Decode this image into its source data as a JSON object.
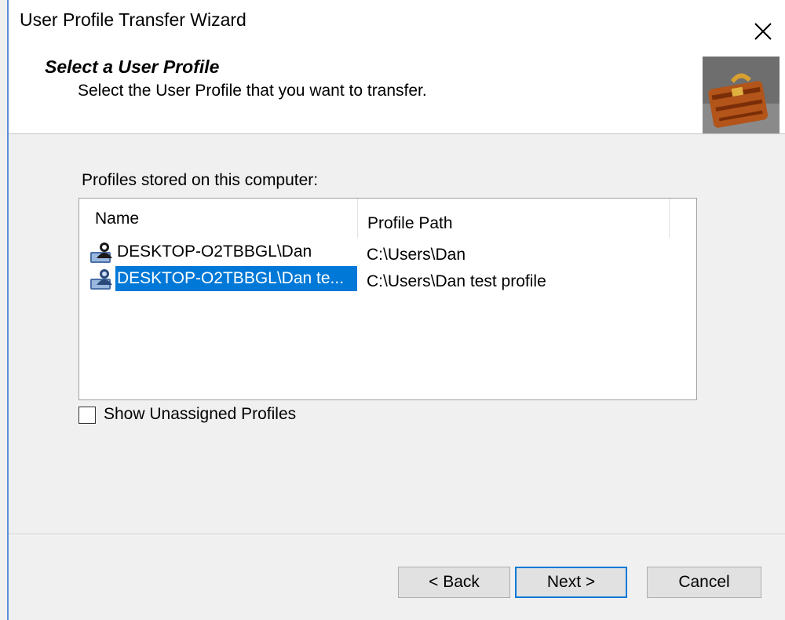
{
  "window": {
    "title": "User Profile Transfer Wizard"
  },
  "header": {
    "title": "Select a User Profile",
    "subtitle": "Select the User Profile that you want to transfer.",
    "image_icon": "briefcase-icon"
  },
  "content": {
    "list_label": "Profiles stored on this computer:",
    "columns": [
      "Name",
      "Profile Path"
    ],
    "rows": [
      {
        "name": "DESKTOP-O2TBBGL\\Dan",
        "path": "C:\\Users\\Dan",
        "selected": false,
        "icon": "user-profile-icon"
      },
      {
        "name": "DESKTOP-O2TBBGL\\Dan te...",
        "path": "C:\\Users\\Dan test profile",
        "selected": true,
        "icon": "user-profile-icon"
      }
    ],
    "show_unassigned_label": "Show Unassigned Profiles",
    "show_unassigned_checked": false
  },
  "buttons": {
    "back": "< Back",
    "next": "Next >",
    "cancel": "Cancel"
  },
  "colors": {
    "selection": "#0078d7",
    "window_border": "#5b8fd6"
  }
}
